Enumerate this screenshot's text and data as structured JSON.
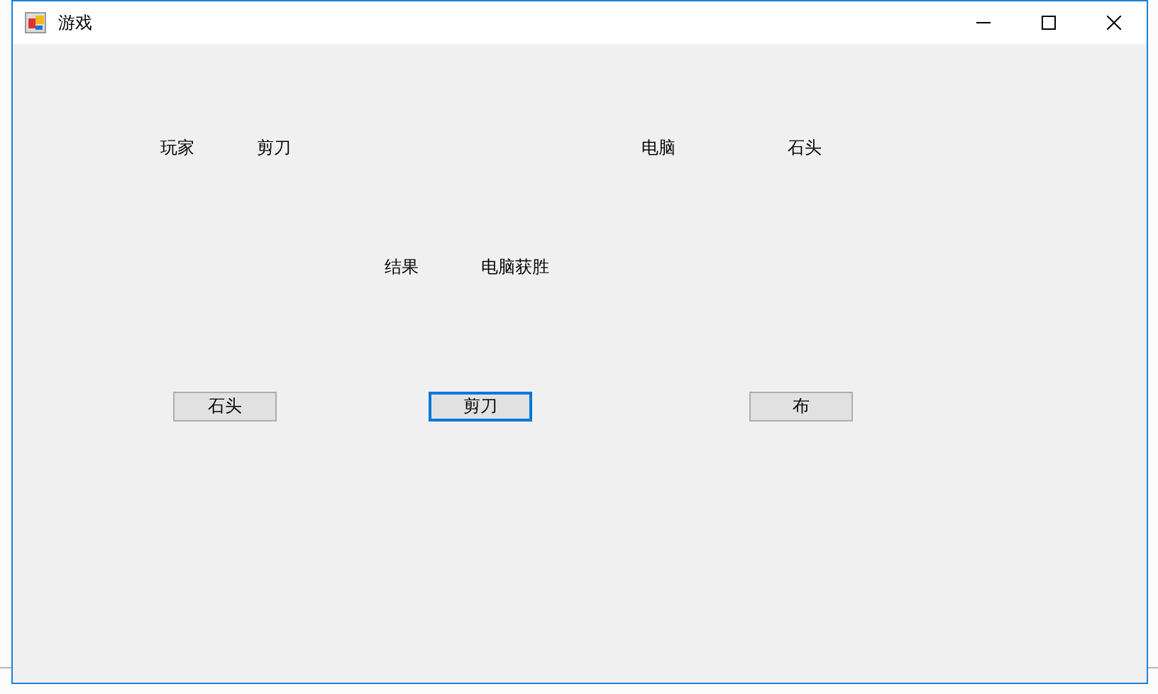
{
  "window": {
    "title": "游戏"
  },
  "labels": [
    {
      "text": "玩家"
    },
    {
      "text": "剪刀"
    },
    {
      "text": "电脑"
    },
    {
      "text": "石头"
    },
    {
      "text": "结果"
    },
    {
      "text": "电脑获胜"
    }
  ],
  "buttons": [
    {
      "label": "石头",
      "focused": false
    },
    {
      "label": "剪刀",
      "focused": true
    },
    {
      "label": "布",
      "focused": false
    }
  ]
}
